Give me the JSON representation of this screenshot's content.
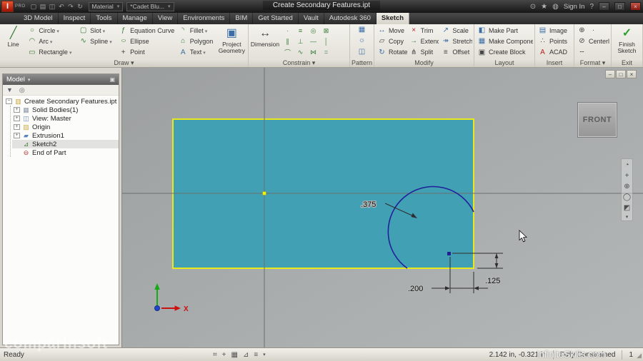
{
  "titlebar": {
    "logo_text": "I",
    "logo_sub": "PRO",
    "material_combo": "Material",
    "appearance_combo": "*Cadet Blu...",
    "doc_title": "Create Secondary Features.ipt",
    "sign_in_label": "Sign In",
    "help_label": "?"
  },
  "tabs": {
    "items": [
      "3D Model",
      "Inspect",
      "Tools",
      "Manage",
      "View",
      "Environments",
      "BIM",
      "Get Started",
      "Vault",
      "Autodesk 360",
      "Sketch"
    ],
    "active": "Sketch"
  },
  "ribbon": {
    "panel_labels": {
      "draw": "Draw ▾",
      "constrain": "Constrain ▾",
      "pattern": "Pattern",
      "modify": "Modify",
      "layout": "Layout",
      "insert": "Insert",
      "format": "Format ▾",
      "exit": "Exit"
    },
    "buttons": {
      "line": "Line",
      "circle": "Circle",
      "arc": "Arc",
      "rectangle": "Rectangle",
      "slot": "Slot",
      "spline": "Spline",
      "equation_curve": "Equation Curve",
      "ellipse": "Ellipse",
      "point": "Point",
      "fillet": "Fillet",
      "polygon": "Polygon",
      "text": "Text",
      "project_geometry": "Project Geometry",
      "dimension": "Dimension",
      "move": "Move",
      "copy": "Copy",
      "rotate": "Rotate",
      "trim": "Trim",
      "extend": "Extend",
      "split": "Split",
      "scale": "Scale",
      "stretch": "Stretch",
      "offset": "Offset",
      "make_part": "Make Part",
      "make_components": "Make Components",
      "create_block": "Create Block",
      "image": "Image",
      "points": "Points",
      "acad": "ACAD",
      "centerline": "Centerline",
      "finish_sketch": "Finish Sketch"
    }
  },
  "browser": {
    "header": "Model",
    "items": [
      {
        "label": "Create Secondary Features.ipt"
      },
      {
        "label": "Solid Bodies(1)"
      },
      {
        "label": "View: Master"
      },
      {
        "label": "Origin"
      },
      {
        "label": "Extrusion1"
      },
      {
        "label": "Sketch2"
      },
      {
        "label": "End of Part"
      }
    ]
  },
  "canvas": {
    "viewcube_label": "FRONT",
    "x_axis_label": "X",
    "dimensions": {
      "radius": ".375",
      "width": ".200",
      "height": ".125"
    },
    "colors": {
      "fill": "#41a0b4",
      "border": "#e8e81a",
      "arc": "#20209a",
      "axis": "#6a6f70"
    }
  },
  "statusbar": {
    "ready": "Ready",
    "coordinates": "2.142 in, -0.321 in",
    "constraint_status": "Fully Constrained",
    "dof_count": "1"
  },
  "watermarks": {
    "left": "comparinsoft",
    "right": "InfiniteSkills.com"
  }
}
